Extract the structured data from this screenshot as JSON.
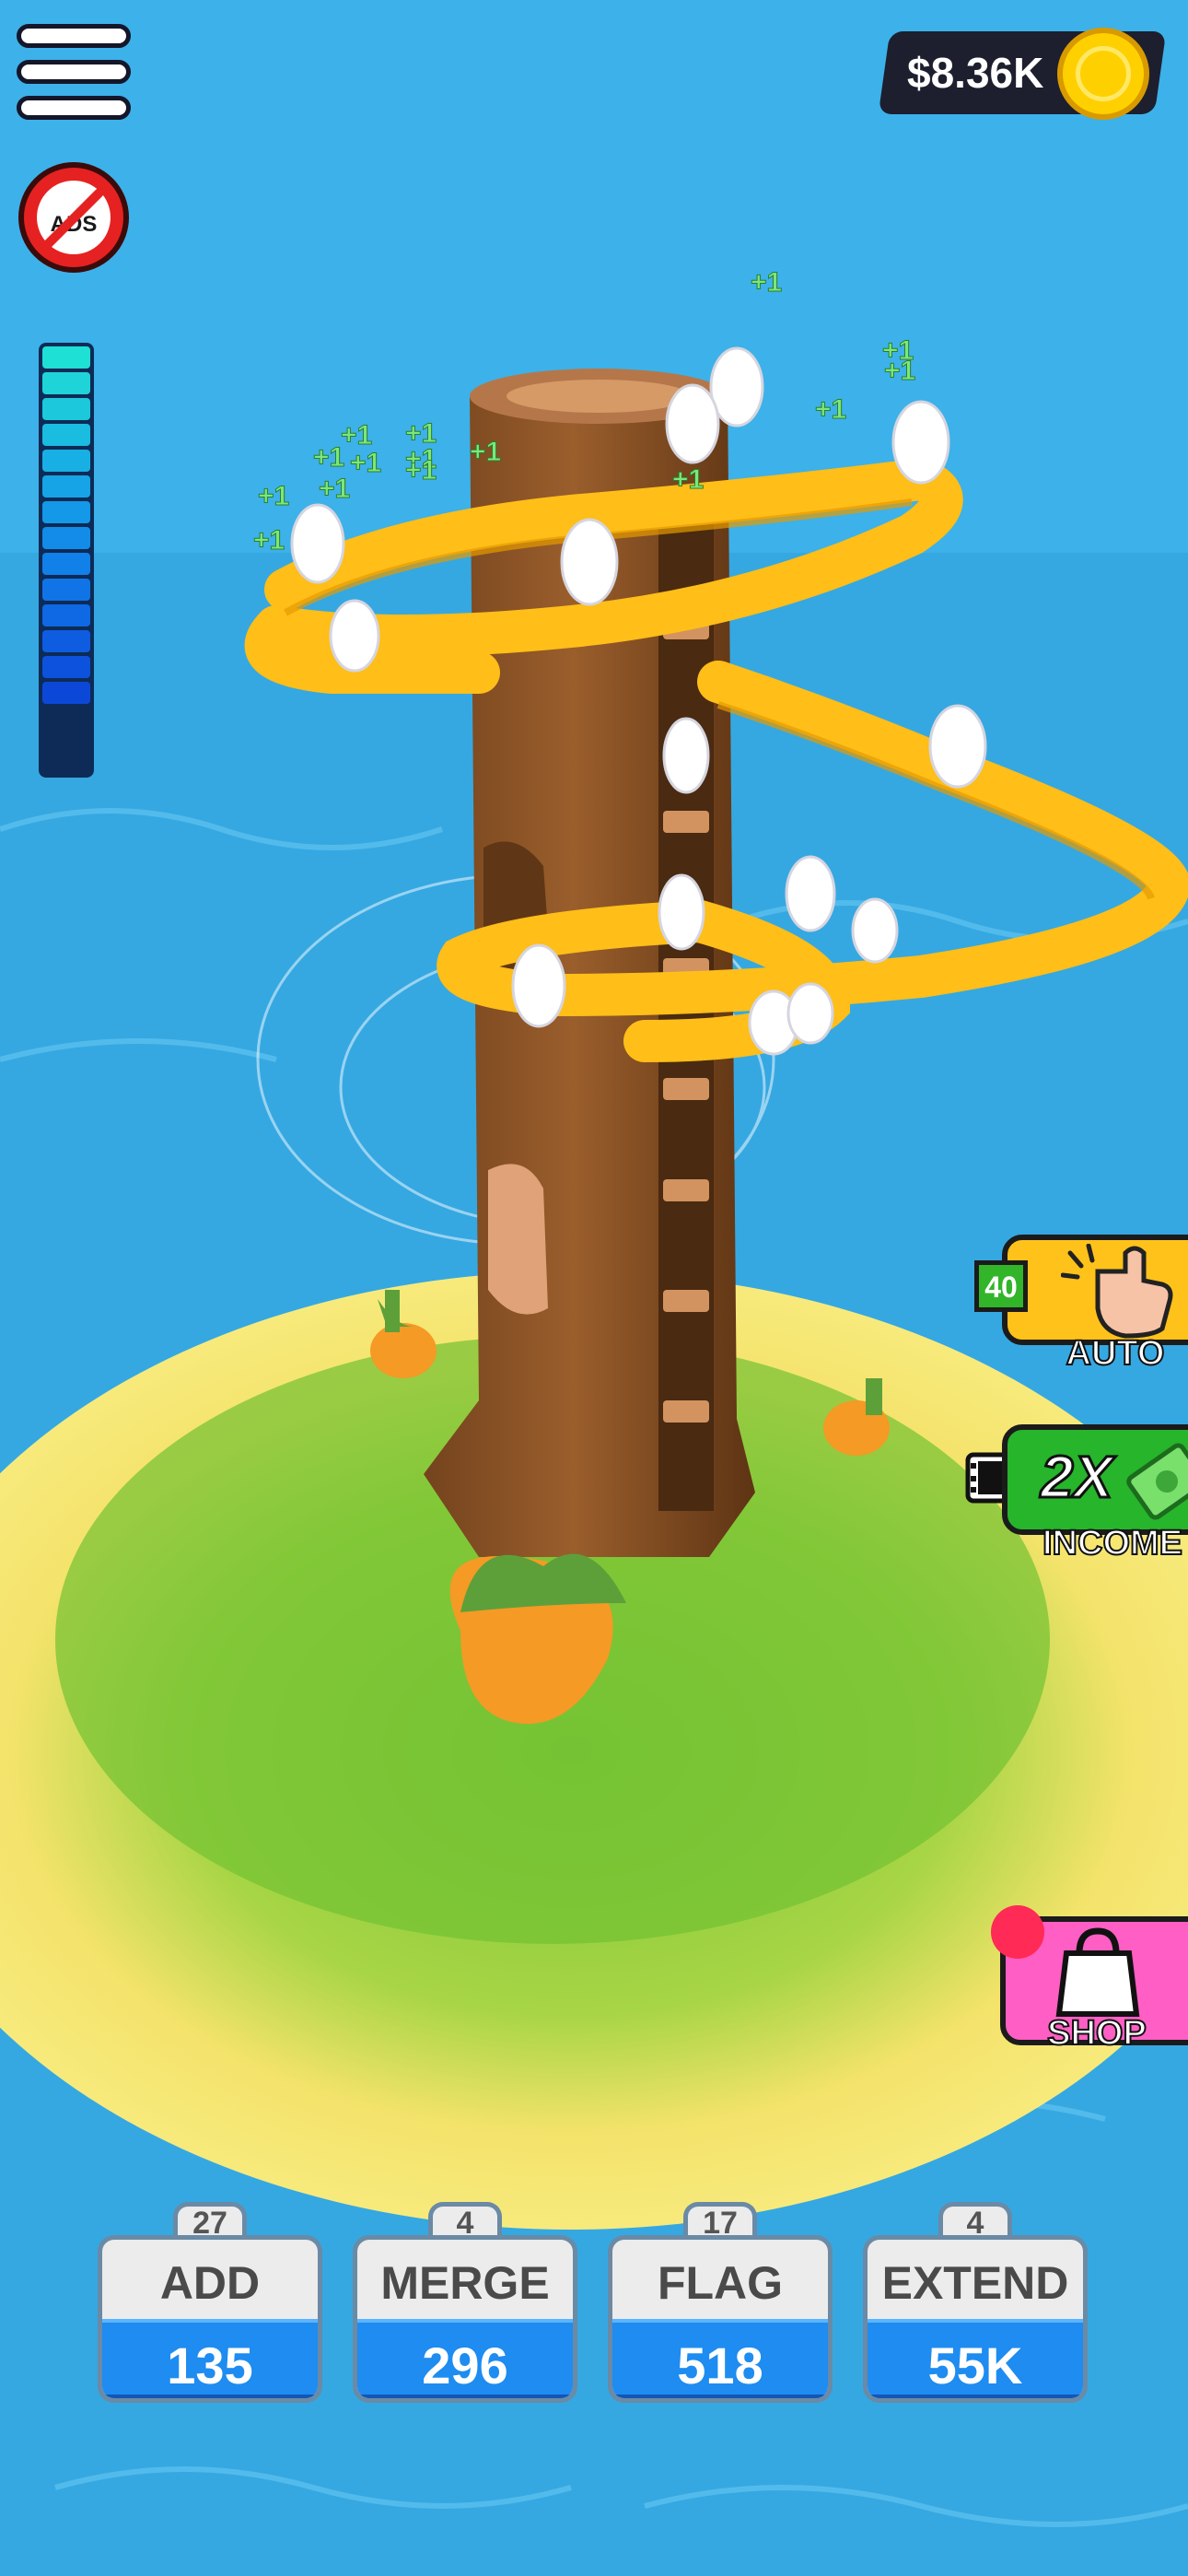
{
  "hud": {
    "money": "$8.36K",
    "energy_level": 1.0
  },
  "floating_income_labels": [
    "+1",
    "+1",
    "+1",
    "+1",
    "+1",
    "+1",
    "+1",
    "+1",
    "+1",
    "+1",
    "+1",
    "+1",
    "+1",
    "+1",
    "+1"
  ],
  "side_buttons": {
    "auto": {
      "count": "40",
      "label": "AUTO"
    },
    "income": {
      "multiplier": "2X",
      "label": "INCOME"
    },
    "shop": {
      "label": "SHOP"
    }
  },
  "upgrades": [
    {
      "level": "27",
      "name": "ADD",
      "cost": "135"
    },
    {
      "level": "4",
      "name": "MERGE",
      "cost": "296"
    },
    {
      "level": "17",
      "name": "FLAG",
      "cost": "518"
    },
    {
      "level": "4",
      "name": "EXTEND",
      "cost": "55K"
    }
  ],
  "icons": {
    "menu": "hamburger-icon",
    "no_ads": "no-ads-icon",
    "coin": "coin-icon",
    "tap": "tap-hand-icon",
    "video": "video-ad-icon",
    "bag": "shopping-bag-icon"
  },
  "colors": {
    "water": "#33a6e0",
    "island_grass": "#7cc63a",
    "sand": "#f4e36b",
    "trunk": "#8a5327",
    "slide": "#ffbe18",
    "cost_bar": "#1e8cf0"
  }
}
